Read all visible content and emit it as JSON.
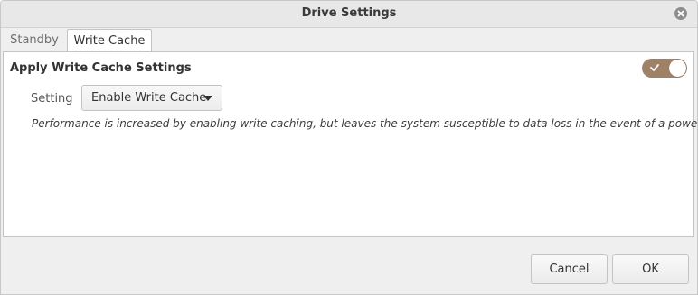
{
  "window": {
    "title": "Drive Settings"
  },
  "tabs": [
    {
      "label": "Standby",
      "selected": false
    },
    {
      "label": "Write Cache",
      "selected": true
    }
  ],
  "write_cache": {
    "section_title": "Apply Write Cache Settings",
    "apply_enabled": true,
    "setting_label": "Setting",
    "setting_value": "Enable Write Cache",
    "description": "Performance is increased by enabling write caching, but leaves the system susceptible to data loss in the event of a power failure"
  },
  "buttons": {
    "cancel": "Cancel",
    "ok": "OK"
  },
  "colors": {
    "accent": "#9f8168",
    "panel_bg": "#ffffff",
    "window_bg": "#efefef"
  },
  "icons": {
    "close": "close-icon",
    "switch_check": "check-icon",
    "dropdown": "triangle-down-icon"
  }
}
